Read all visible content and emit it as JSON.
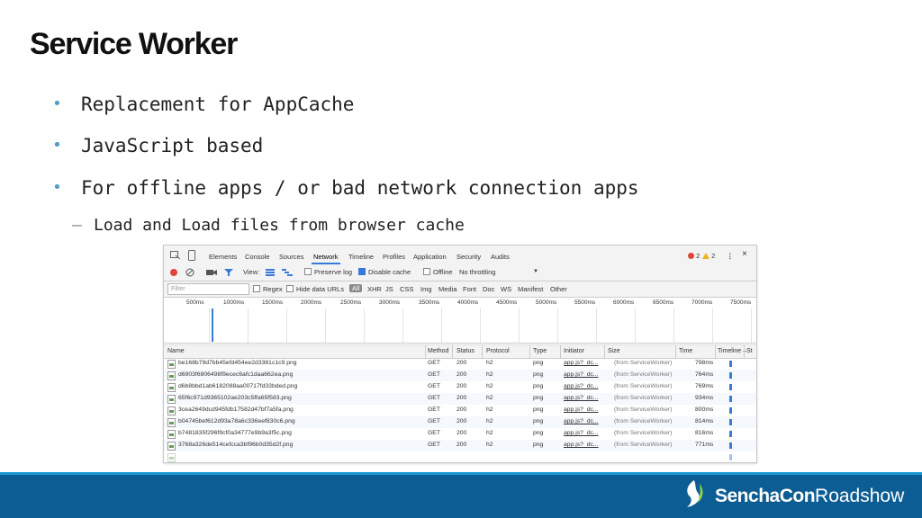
{
  "slide": {
    "title": "Service Worker",
    "bullets": [
      "Replacement for AppCache",
      "JavaScript based",
      "For offline apps / or bad network connection apps"
    ],
    "sub_bullet": "Load and Load files from browser cache",
    "bullet_glyph": "•",
    "dash_glyph": "–"
  },
  "devtools": {
    "tabs": [
      "Elements",
      "Console",
      "Sources",
      "Network",
      "Timeline",
      "Profiles",
      "Application",
      "Security",
      "Audits"
    ],
    "active_tab": "Network",
    "errors": "2",
    "warnings": "2",
    "toolbar": {
      "view_label": "View:",
      "preserve_log": "Preserve log",
      "disable_cache": "Disable cache",
      "offline": "Offline",
      "throttling": "No throttling"
    },
    "filter": {
      "placeholder": "Filter",
      "regex": "Regex",
      "hide_data_urls": "Hide data URLs",
      "types": [
        "All",
        "XHR",
        "JS",
        "CSS",
        "Img",
        "Media",
        "Font",
        "Doc",
        "WS",
        "Manifest",
        "Other"
      ]
    },
    "ticks": [
      "500ms",
      "1000ms",
      "1500ms",
      "2000ms",
      "2500ms",
      "3000ms",
      "3500ms",
      "4000ms",
      "4500ms",
      "5000ms",
      "5500ms",
      "6000ms",
      "6500ms",
      "7000ms",
      "7500ms"
    ],
    "columns": [
      "Name",
      "Method",
      "Status",
      "Protocol",
      "Type",
      "Initiator",
      "Size",
      "Time",
      "Timeline –",
      "St"
    ],
    "rows": [
      {
        "name": "be168b79d7bb45efd454ee2d3381c1c9.png",
        "method": "GET",
        "status": "200",
        "protocol": "h2",
        "type": "png",
        "initiator": "app.js?_dc...",
        "size": "(from ServiceWorker)",
        "time": "798ms"
      },
      {
        "name": "d6903f6806498f9ecec6afc1daa662ea.png",
        "method": "GET",
        "status": "200",
        "protocol": "h2",
        "type": "png",
        "initiator": "app.js?_dc...",
        "size": "(from ServiceWorker)",
        "time": "764ms"
      },
      {
        "name": "d6b8bbd1ab6182088aa00717fd33bded.png",
        "method": "GET",
        "status": "200",
        "protocol": "h2",
        "type": "png",
        "initiator": "app.js?_dc...",
        "size": "(from ServiceWorker)",
        "time": "769ms"
      },
      {
        "name": "65f6c971d9365102ae203c5ffa65f583.png",
        "method": "GET",
        "status": "200",
        "protocol": "h2",
        "type": "png",
        "initiator": "app.js?_dc...",
        "size": "(from ServiceWorker)",
        "time": "934ms"
      },
      {
        "name": "3cea2649dcd945fdb17582d47bf7a5fa.png",
        "method": "GET",
        "status": "200",
        "protocol": "h2",
        "type": "png",
        "initiator": "app.js?_dc...",
        "size": "(from ServiceWorker)",
        "time": "800ms"
      },
      {
        "name": "b04745bef612d93a78a6c336eef830c6.png",
        "method": "GET",
        "status": "200",
        "protocol": "h2",
        "type": "png",
        "initiator": "app.js?_dc...",
        "size": "(from ServiceWorker)",
        "time": "814ms"
      },
      {
        "name": "b7481835f296f9cf0a34777e9b9a3f5c.png",
        "method": "GET",
        "status": "200",
        "protocol": "h2",
        "type": "png",
        "initiator": "app.js?_dc...",
        "size": "(from ServiceWorker)",
        "time": "816ms"
      },
      {
        "name": "3768a326de514cefcca3bf96b0d35d2f.png",
        "method": "GET",
        "status": "200",
        "protocol": "h2",
        "type": "png",
        "initiator": "app.js?_dc...",
        "size": "(from ServiceWorker)",
        "time": "771ms"
      }
    ]
  },
  "footer": {
    "brand_bold": "SenchaCon",
    "brand_light": "Roadshow"
  },
  "colors": {
    "accent": "#3879d9",
    "footer_bg": "#0c5d93",
    "footer_band": "#1c9ad6",
    "bullet": "#4f9cc9"
  },
  "icons": [
    "record-icon",
    "clear-icon",
    "camera-icon",
    "filter-icon",
    "large-rows-icon",
    "waterfall-icon",
    "error-icon",
    "warning-icon",
    "more-icon",
    "close-icon",
    "sencha-logo"
  ]
}
